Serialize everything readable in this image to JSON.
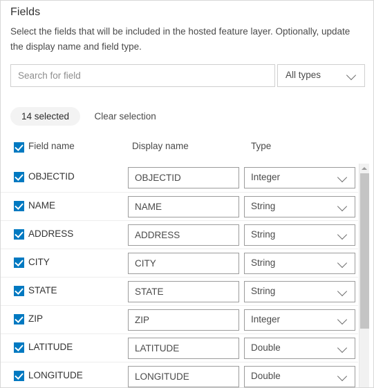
{
  "panel": {
    "heading": "Fields",
    "description": "Select the fields that will be included in the hosted feature layer. Optionally, update the display name and field type."
  },
  "search": {
    "value": "",
    "placeholder": "Search for field"
  },
  "type_filter": {
    "selected": "All types",
    "chevron_icon": "chevron-down-icon"
  },
  "selection": {
    "count_label": "14 selected",
    "clear_label": "Clear selection"
  },
  "table": {
    "headers": {
      "field_name": "Field name",
      "display_name": "Display name",
      "type": "Type"
    },
    "select_all_checked": true,
    "rows": [
      {
        "checked": true,
        "field_name": "OBJECTID",
        "display_name": "OBJECTID",
        "type": "Integer"
      },
      {
        "checked": true,
        "field_name": "NAME",
        "display_name": "NAME",
        "type": "String"
      },
      {
        "checked": true,
        "field_name": "ADDRESS",
        "display_name": "ADDRESS",
        "type": "String"
      },
      {
        "checked": true,
        "field_name": "CITY",
        "display_name": "CITY",
        "type": "String"
      },
      {
        "checked": true,
        "field_name": "STATE",
        "display_name": "STATE",
        "type": "String"
      },
      {
        "checked": true,
        "field_name": "ZIP",
        "display_name": "ZIP",
        "type": "Integer"
      },
      {
        "checked": true,
        "field_name": "LATITUDE",
        "display_name": "LATITUDE",
        "type": "Double"
      },
      {
        "checked": true,
        "field_name": "LONGITUDE",
        "display_name": "LONGITUDE",
        "type": "Double"
      }
    ]
  },
  "scrollbar": {
    "up_arrow_icon": "triangle-up-icon"
  },
  "colors": {
    "accent": "#0079c1",
    "text": "#323232",
    "muted_text": "#4a4a4a",
    "placeholder": "#8e8e8e",
    "chip_background": "#f3f3f3",
    "border": "#cfcfcf"
  }
}
